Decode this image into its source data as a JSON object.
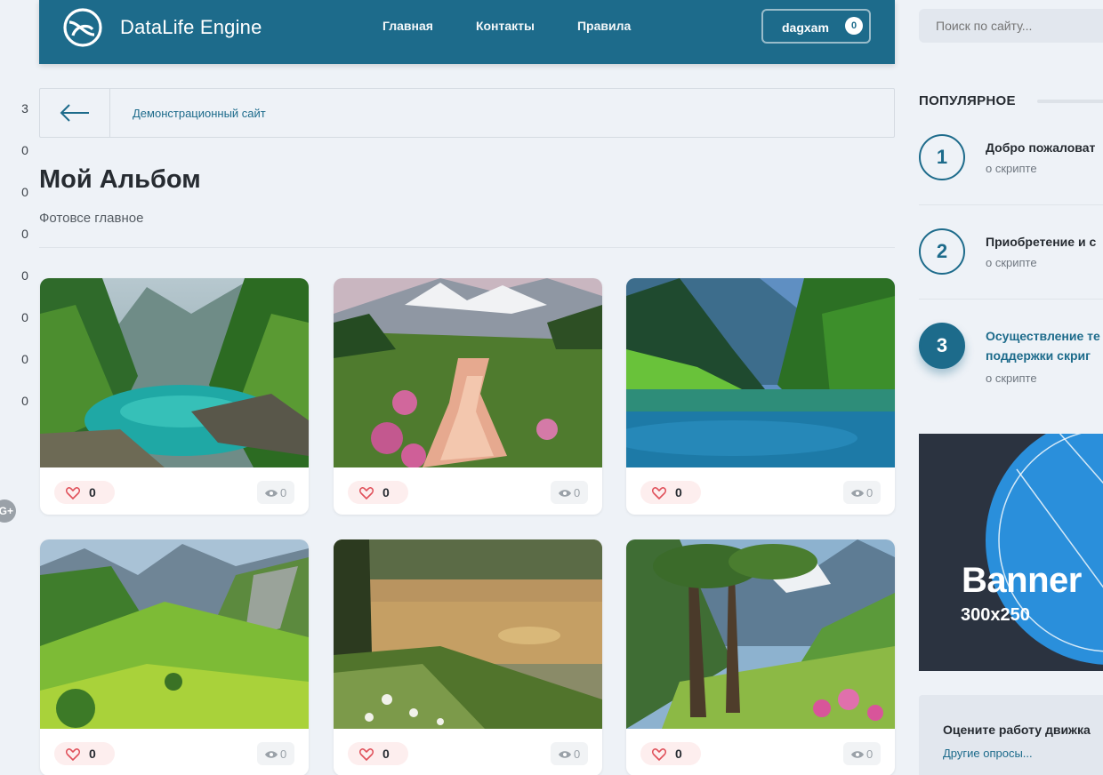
{
  "side_counts": [
    "3",
    "0",
    "0",
    "0",
    "0",
    "0",
    "0",
    "0"
  ],
  "share_label": "G+",
  "header": {
    "logo_text": "DataLife Engine",
    "nav": [
      "Главная",
      "Контакты",
      "Правила"
    ],
    "user_name": "dagxam",
    "user_count": "0",
    "accent": "#1d6b8b"
  },
  "breadcrumb": {
    "link": "Демонстрационный сайт"
  },
  "page": {
    "title": "Мой Альбом",
    "subtitle": "Фотовсе главное"
  },
  "cards": [
    {
      "scene": "turquoise-lake-forest",
      "likes": "0",
      "views": "0"
    },
    {
      "scene": "alpine-meadow-stream",
      "likes": "0",
      "views": "0"
    },
    {
      "scene": "blue-river-forest",
      "likes": "0",
      "views": "0"
    },
    {
      "scene": "green-valley-mountains",
      "likes": "0",
      "views": "0"
    },
    {
      "scene": "sunset-pond",
      "likes": "0",
      "views": "0"
    },
    {
      "scene": "trees-flower-valley",
      "likes": "0",
      "views": "0"
    }
  ],
  "search": {
    "placeholder": "Поиск по сайту..."
  },
  "popular": {
    "title": "ПОПУЛЯРНОЕ",
    "items": [
      {
        "num": "1",
        "title": "Добро пожаловат",
        "category": "о скрипте"
      },
      {
        "num": "2",
        "title": "Приобретение и с",
        "category": "о скрипте"
      },
      {
        "num": "3",
        "title_line1": "Осуществление те",
        "title_line2": "поддержки скриг",
        "category": "о скрипте"
      }
    ]
  },
  "banner": {
    "big": "Banner",
    "small": "300x250"
  },
  "poll": {
    "question": "Оцените работу движка",
    "more": "Другие опросы..."
  }
}
